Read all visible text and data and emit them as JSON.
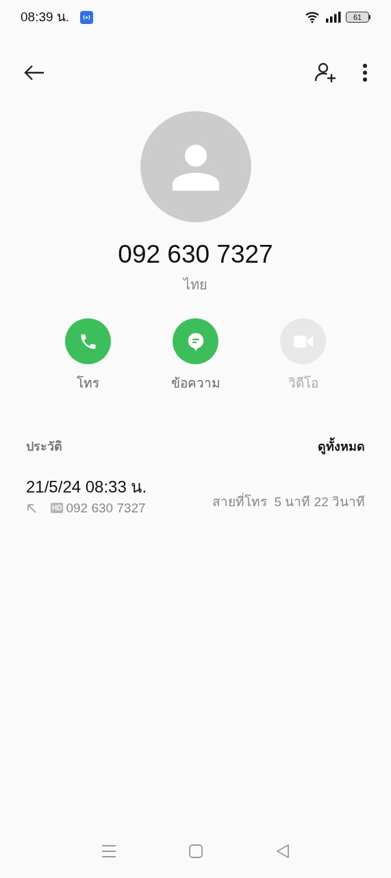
{
  "status_bar": {
    "time": "08:39 น.",
    "battery": "61"
  },
  "contact": {
    "number": "092 630 7327",
    "location": "ไทย"
  },
  "actions": [
    {
      "kind": "call",
      "label": "โทร",
      "disabled": false
    },
    {
      "kind": "message",
      "label": "ข้อความ",
      "disabled": false
    },
    {
      "kind": "video",
      "label": "วิดีโอ",
      "disabled": true
    }
  ],
  "history": {
    "title": "ประวัติ",
    "see_all": "ดูทั้งหมด",
    "entries": [
      {
        "datetime": "21/5/24 08:33 น.",
        "badge": "HD",
        "number": "092 630 7327",
        "detail": "สายที่โทร  5 นาที 22 วินาที"
      }
    ]
  }
}
